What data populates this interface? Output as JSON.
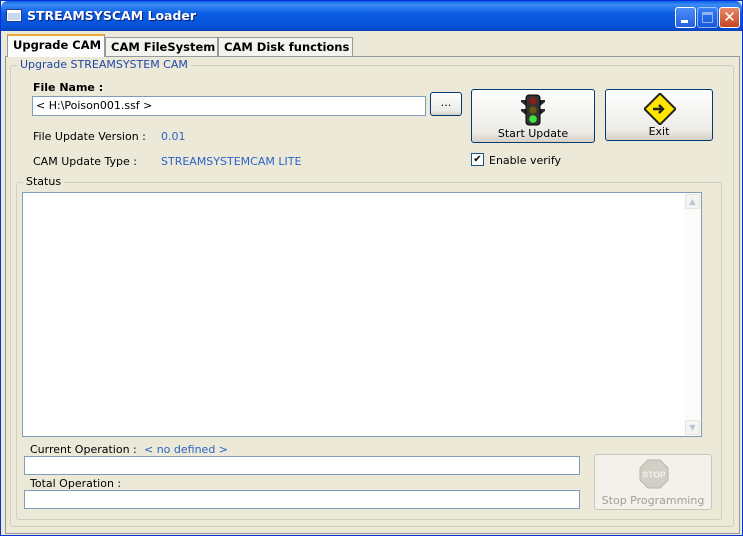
{
  "window": {
    "title": "STREAMSYSCAM Loader",
    "accent_color": "#0a5fe7",
    "controls": {
      "minimize_icon": "minimize-icon",
      "maximize_icon": "maximize-icon",
      "close_glyph": "✕"
    }
  },
  "tabs": [
    {
      "label": "Upgrade CAM",
      "active": true
    },
    {
      "label": "CAM FileSystem",
      "active": false
    },
    {
      "label": "CAM Disk functions",
      "active": false
    }
  ],
  "upgrade": {
    "group_label": "Upgrade STREAMSYSTEM CAM",
    "file_name_label": "File Name :",
    "file_name_value": "< H:\\Poison001.ssf >",
    "browse_label": "...",
    "version_label": "File Update Version :",
    "version_value": "0.01",
    "type_label": "CAM Update Type :",
    "type_value": "STREAMSYSTEMCAM LITE",
    "start_update_label": "Start Update",
    "exit_label": "Exit",
    "enable_verify_label": "Enable verify",
    "enable_verify_checked": true,
    "check_glyph": "✔"
  },
  "status": {
    "group_label": "Status",
    "log_text": "",
    "scroll_up_glyph": "▲",
    "scroll_down_glyph": "▼"
  },
  "operations": {
    "current_label": "Current Operation :",
    "current_value": "< no defined >",
    "total_label": "Total Operation :",
    "current_progress": 0,
    "total_progress": 0
  },
  "stop": {
    "label": "Stop Programming",
    "icon_text": "STOP",
    "enabled": false
  }
}
